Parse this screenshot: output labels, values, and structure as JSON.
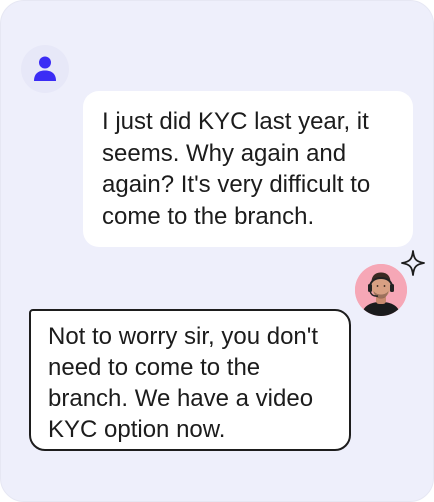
{
  "conversation": {
    "user_message": "I just did KYC last year, it seems. Why again and again? It's very difficult to come to the branch.",
    "agent_message": "Not to worry sir, you don't need to come to the branch. We have a video KYC option now."
  },
  "icons": {
    "user_avatar": "person-icon",
    "agent_avatar": "agent-avatar-headset",
    "sparkle": "sparkle-icon"
  },
  "colors": {
    "canvas_background": "#eeeffb",
    "user_icon": "#3b2cf5",
    "agent_avatar_background": "#f6a7b6",
    "agent_bubble_border": "#1d1d1d"
  }
}
